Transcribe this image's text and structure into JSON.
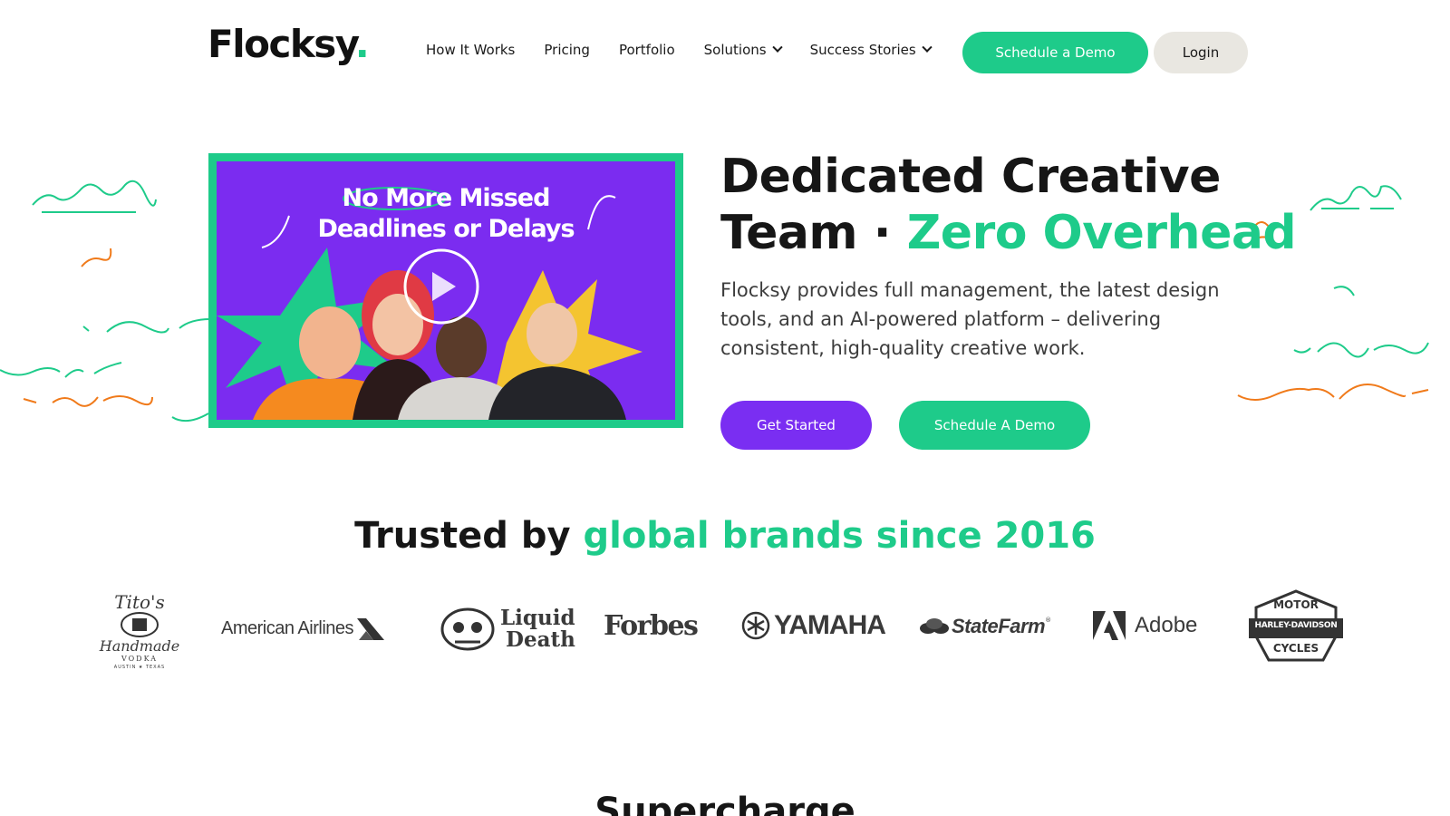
{
  "nav": {
    "logo_text": "Flocksy",
    "logo_dot": ".",
    "links": [
      {
        "label": "How It Works"
      },
      {
        "label": "Pricing"
      },
      {
        "label": "Portfolio"
      },
      {
        "label": "Solutions"
      },
      {
        "label": "Success Stories"
      }
    ],
    "demo_button": "Schedule a Demo",
    "login_button": "Login"
  },
  "hero": {
    "video": {
      "headline_line1": "No More Missed",
      "headline_line2": "Deadlines or Delays",
      "play_icon": "play-icon"
    },
    "title_part1": "Dedicated Creative",
    "title_part2": "Team",
    "title_separator": "·",
    "title_accent": "Zero Overhead",
    "subtitle": "Flocksy provides full management, the latest design tools, and an AI-powered platform – delivering consistent, high-quality creative work.",
    "get_started": "Get Started",
    "schedule_demo": "Schedule A Demo"
  },
  "trusted": {
    "heading_plain": "Trusted by ",
    "heading_accent": "global brands since 2016",
    "brands": [
      {
        "name": "Tito's",
        "line2": "Handmade",
        "line3": "VODKA",
        "line4": "AUSTIN ★ TEXAS"
      },
      {
        "name": "American Airlines"
      },
      {
        "name": "Liquid",
        "line2": "Death"
      },
      {
        "name": "Forbes"
      },
      {
        "name": "YAMAHA"
      },
      {
        "name": "StateFarm",
        "mark": "®"
      },
      {
        "name": "Adobe"
      },
      {
        "name": "MOTOR",
        "line2": "HARLEY-DAVIDSON",
        "line3": "CYCLES"
      }
    ]
  },
  "next_section": {
    "heading": "Supercharge"
  },
  "colors": {
    "green": "#1ecb8a",
    "purple": "#7a2ef2",
    "orange": "#f07a1a",
    "login_bg": "#e9e7e1"
  }
}
